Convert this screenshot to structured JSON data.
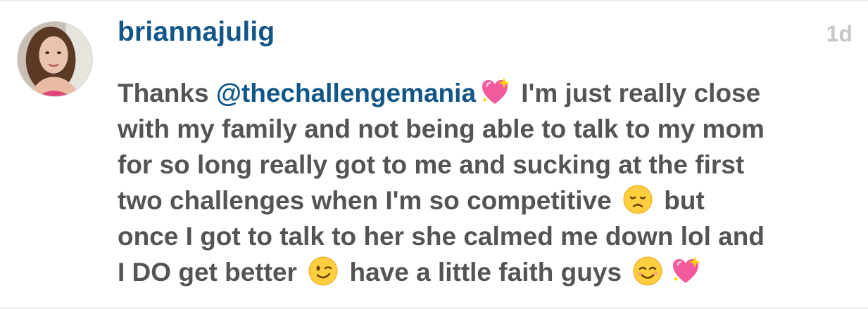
{
  "comment": {
    "username": "briannajulig",
    "timestamp": "1d",
    "avatar_icon": "profile-photo",
    "colors": {
      "username": "#125688",
      "mention": "#125688",
      "body_text": "#545454",
      "timestamp": "#c7c7c7"
    },
    "lines": {
      "l1_a": "Thanks ",
      "l1_mention": "@thechallengemania",
      "l1_b": " I'm just really close",
      "l2": "with my family and not being able to talk to my mom",
      "l3": "for so long really got to me and sucking at the first",
      "l4_a": "two challenges when I'm so competitive ",
      "l4_b": " but",
      "l5": "once I got to talk to her she calmed me down lol and",
      "l6_a": "I DO get better ",
      "l6_b": " have a little faith guys "
    },
    "emojis": [
      "sparkling-heart-icon",
      "disappointed-face-icon",
      "winking-face-icon",
      "smiling-face-icon",
      "sparkling-heart-icon"
    ]
  }
}
